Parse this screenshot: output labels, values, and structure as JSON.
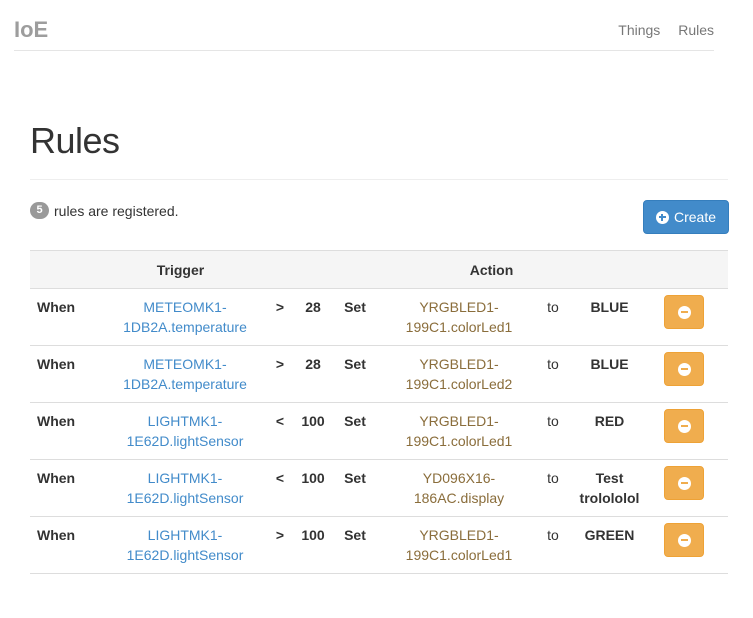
{
  "nav": {
    "brand": "IoE",
    "links": [
      "Things",
      "Rules"
    ]
  },
  "page": {
    "title": "Rules",
    "count": "5",
    "count_text": "rules are registered.",
    "create_label": "Create"
  },
  "table": {
    "headers": {
      "trigger": "Trigger",
      "action": "Action"
    },
    "rows": [
      {
        "when": "When",
        "sensor": [
          "METEOMK1-",
          "1DB2A.temperature"
        ],
        "op": ">",
        "value": "28",
        "set": "Set",
        "actuator": [
          "YRGBLED1-",
          "199C1.colorLed1"
        ],
        "to": "to",
        "target": [
          "BLUE"
        ]
      },
      {
        "when": "When",
        "sensor": [
          "METEOMK1-",
          "1DB2A.temperature"
        ],
        "op": ">",
        "value": "28",
        "set": "Set",
        "actuator": [
          "YRGBLED1-",
          "199C1.colorLed2"
        ],
        "to": "to",
        "target": [
          "BLUE"
        ]
      },
      {
        "when": "When",
        "sensor": [
          "LIGHTMK1-",
          "1E62D.lightSensor"
        ],
        "op": "<",
        "value": "100",
        "set": "Set",
        "actuator": [
          "YRGBLED1-",
          "199C1.colorLed1"
        ],
        "to": "to",
        "target": [
          "RED"
        ]
      },
      {
        "when": "When",
        "sensor": [
          "LIGHTMK1-",
          "1E62D.lightSensor"
        ],
        "op": "<",
        "value": "100",
        "set": "Set",
        "actuator": [
          "YD096X16-",
          "186AC.display"
        ],
        "to": "to",
        "target": [
          "Test",
          "trolololol"
        ]
      },
      {
        "when": "When",
        "sensor": [
          "LIGHTMK1-",
          "1E62D.lightSensor"
        ],
        "op": ">",
        "value": "100",
        "set": "Set",
        "actuator": [
          "YRGBLED1-",
          "199C1.colorLed1"
        ],
        "to": "to",
        "target": [
          "GREEN"
        ]
      }
    ]
  },
  "colors": {
    "primary": "#428bca",
    "warning": "#f0ad4e",
    "sensor_link": "#428bca",
    "actuator_text": "#8a6d3b"
  },
  "icons": {
    "create": "plus-circle-icon",
    "delete": "minus-circle-icon"
  }
}
